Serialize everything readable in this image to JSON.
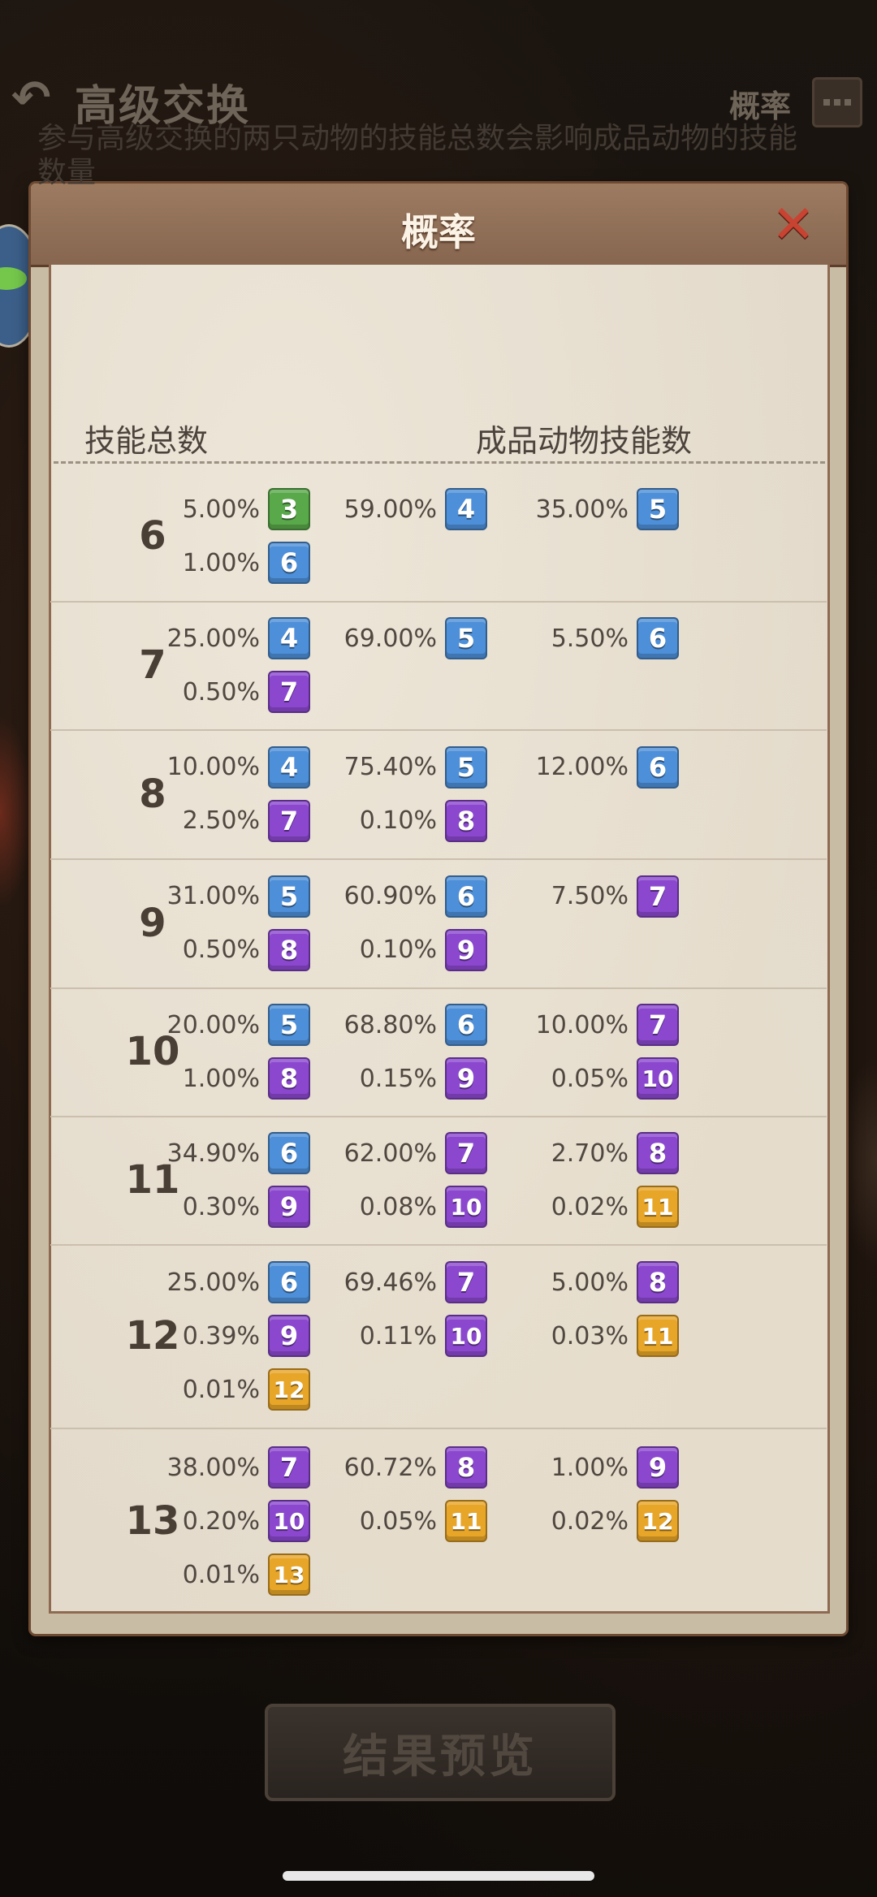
{
  "header": {
    "title": "高级交换",
    "probability_label": "概率"
  },
  "dialog": {
    "title": "概率",
    "description": "参与高级交换的两只动物的技能总数会影响成品动物的技能数量",
    "col_total": "技能总数",
    "col_result": "成品动物技能数"
  },
  "colors": {
    "green": "#59a84a",
    "blue": "#4d8fd8",
    "purple": "#8b48cf",
    "gold": "#e8a629"
  },
  "rows": [
    {
      "total": "6",
      "entries": [
        {
          "pct": "5.00%",
          "n": "3",
          "c": "green"
        },
        {
          "pct": "59.00%",
          "n": "4",
          "c": "blue"
        },
        {
          "pct": "35.00%",
          "n": "5",
          "c": "blue"
        },
        {
          "pct": "1.00%",
          "n": "6",
          "c": "blue"
        }
      ]
    },
    {
      "total": "7",
      "entries": [
        {
          "pct": "25.00%",
          "n": "4",
          "c": "blue"
        },
        {
          "pct": "69.00%",
          "n": "5",
          "c": "blue"
        },
        {
          "pct": "5.50%",
          "n": "6",
          "c": "blue"
        },
        {
          "pct": "0.50%",
          "n": "7",
          "c": "purple"
        }
      ]
    },
    {
      "total": "8",
      "entries": [
        {
          "pct": "10.00%",
          "n": "4",
          "c": "blue"
        },
        {
          "pct": "75.40%",
          "n": "5",
          "c": "blue"
        },
        {
          "pct": "12.00%",
          "n": "6",
          "c": "blue"
        },
        {
          "pct": "2.50%",
          "n": "7",
          "c": "purple"
        },
        {
          "pct": "0.10%",
          "n": "8",
          "c": "purple"
        }
      ]
    },
    {
      "total": "9",
      "entries": [
        {
          "pct": "31.00%",
          "n": "5",
          "c": "blue"
        },
        {
          "pct": "60.90%",
          "n": "6",
          "c": "blue"
        },
        {
          "pct": "7.50%",
          "n": "7",
          "c": "purple"
        },
        {
          "pct": "0.50%",
          "n": "8",
          "c": "purple"
        },
        {
          "pct": "0.10%",
          "n": "9",
          "c": "purple"
        }
      ]
    },
    {
      "total": "10",
      "entries": [
        {
          "pct": "20.00%",
          "n": "5",
          "c": "blue"
        },
        {
          "pct": "68.80%",
          "n": "6",
          "c": "blue"
        },
        {
          "pct": "10.00%",
          "n": "7",
          "c": "purple"
        },
        {
          "pct": "1.00%",
          "n": "8",
          "c": "purple"
        },
        {
          "pct": "0.15%",
          "n": "9",
          "c": "purple"
        },
        {
          "pct": "0.05%",
          "n": "10",
          "c": "purple"
        }
      ]
    },
    {
      "total": "11",
      "entries": [
        {
          "pct": "34.90%",
          "n": "6",
          "c": "blue"
        },
        {
          "pct": "62.00%",
          "n": "7",
          "c": "purple"
        },
        {
          "pct": "2.70%",
          "n": "8",
          "c": "purple"
        },
        {
          "pct": "0.30%",
          "n": "9",
          "c": "purple"
        },
        {
          "pct": "0.08%",
          "n": "10",
          "c": "purple"
        },
        {
          "pct": "0.02%",
          "n": "11",
          "c": "gold"
        }
      ]
    },
    {
      "total": "12",
      "entries": [
        {
          "pct": "25.00%",
          "n": "6",
          "c": "blue"
        },
        {
          "pct": "69.46%",
          "n": "7",
          "c": "purple"
        },
        {
          "pct": "5.00%",
          "n": "8",
          "c": "purple"
        },
        {
          "pct": "0.39%",
          "n": "9",
          "c": "purple"
        },
        {
          "pct": "0.11%",
          "n": "10",
          "c": "purple"
        },
        {
          "pct": "0.03%",
          "n": "11",
          "c": "gold"
        },
        {
          "pct": "0.01%",
          "n": "12",
          "c": "gold"
        }
      ]
    },
    {
      "total": "13",
      "entries": [
        {
          "pct": "38.00%",
          "n": "7",
          "c": "purple"
        },
        {
          "pct": "60.72%",
          "n": "8",
          "c": "purple"
        },
        {
          "pct": "1.00%",
          "n": "9",
          "c": "purple"
        },
        {
          "pct": "0.20%",
          "n": "10",
          "c": "purple"
        },
        {
          "pct": "0.05%",
          "n": "11",
          "c": "gold"
        },
        {
          "pct": "0.02%",
          "n": "12",
          "c": "gold"
        },
        {
          "pct": "0.01%",
          "n": "13",
          "c": "gold"
        }
      ]
    }
  ],
  "footer": {
    "result_preview_label": "结果预览"
  }
}
